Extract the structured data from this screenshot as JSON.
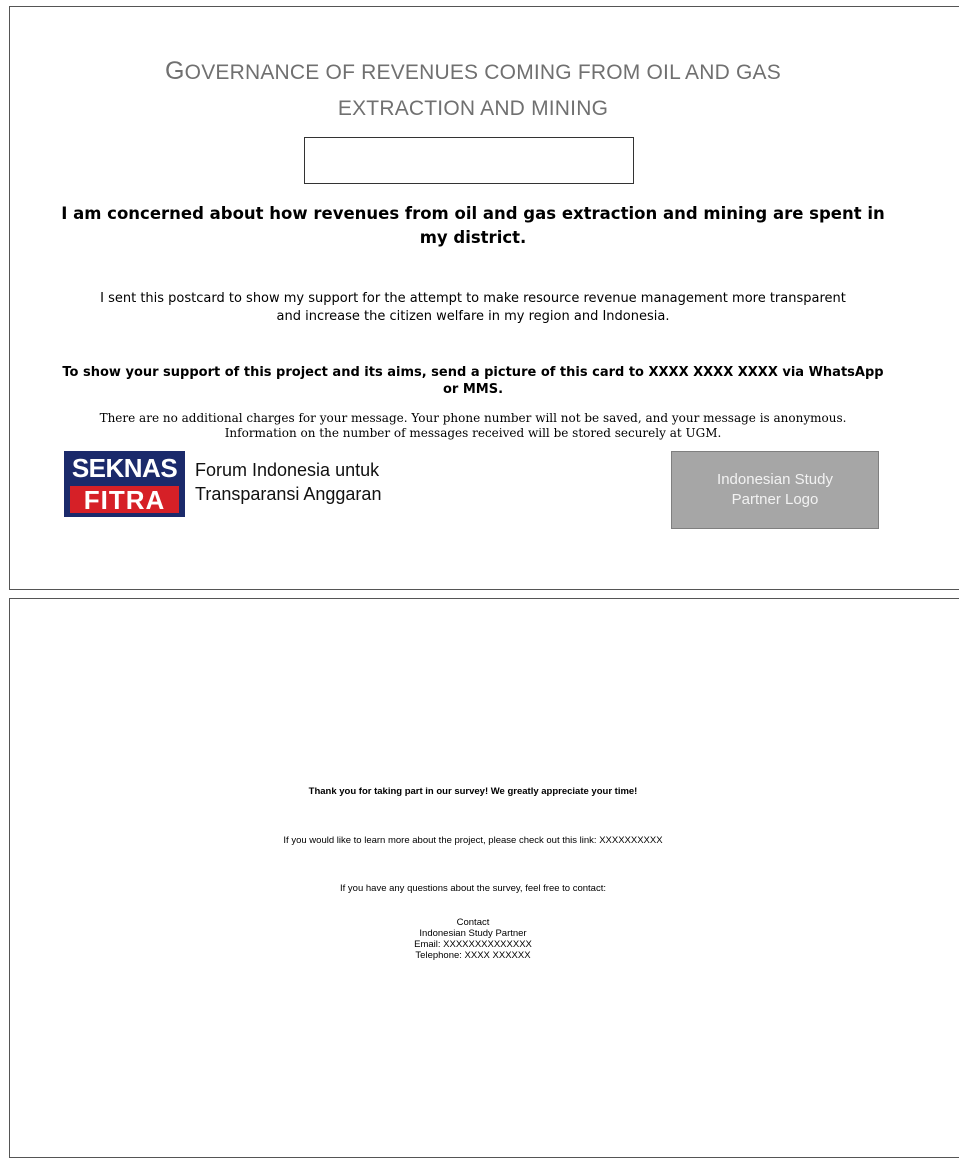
{
  "front": {
    "title_line1_cap": "G",
    "title_line1_rest": "OVERNANCE OF REVENUES COMING FROM OIL AND GAS",
    "title_line2": "EXTRACTION AND MINING",
    "concern": "I am concerned about how revenues from oil and gas extraction and mining are spent in my district.",
    "support": "I sent this postcard to show my support for the attempt to make resource revenue management more transparent and increase the citizen welfare in my region and Indonesia.",
    "send": "To show your support of this project and its aims, send a picture of this card to XXXX XXXX XXXX via WhatsApp or MMS.",
    "charges_line1": "There are no additional charges for your message. Your phone number will not be saved, and your message is anonymous.",
    "charges_line2": "Information on the number of messages received will be stored securely at UGM.",
    "logo": {
      "top": "SEKNAS",
      "bottom": "FITRA",
      "text_line1": "Forum Indonesia untuk",
      "text_line2": "Transparansi Anggaran",
      "colors": {
        "navy": "#1b2a6b",
        "red": "#d62027"
      }
    },
    "partner_logo_label": "Indonesian Study Partner Logo"
  },
  "back": {
    "thanks": "Thank you for taking part in our survey! We greatly appreciate your time!",
    "learn_more": "If you would like to learn more about the project, please check out this link: XXXXXXXXXX",
    "questions": "If you have any questions about the survey, feel free to contact:",
    "contact": {
      "heading": "Contact",
      "org": "Indonesian Study Partner",
      "email": "Email: XXXXXXXXXXXXXX",
      "telephone": "Telephone: XXXX XXXXXX"
    }
  }
}
